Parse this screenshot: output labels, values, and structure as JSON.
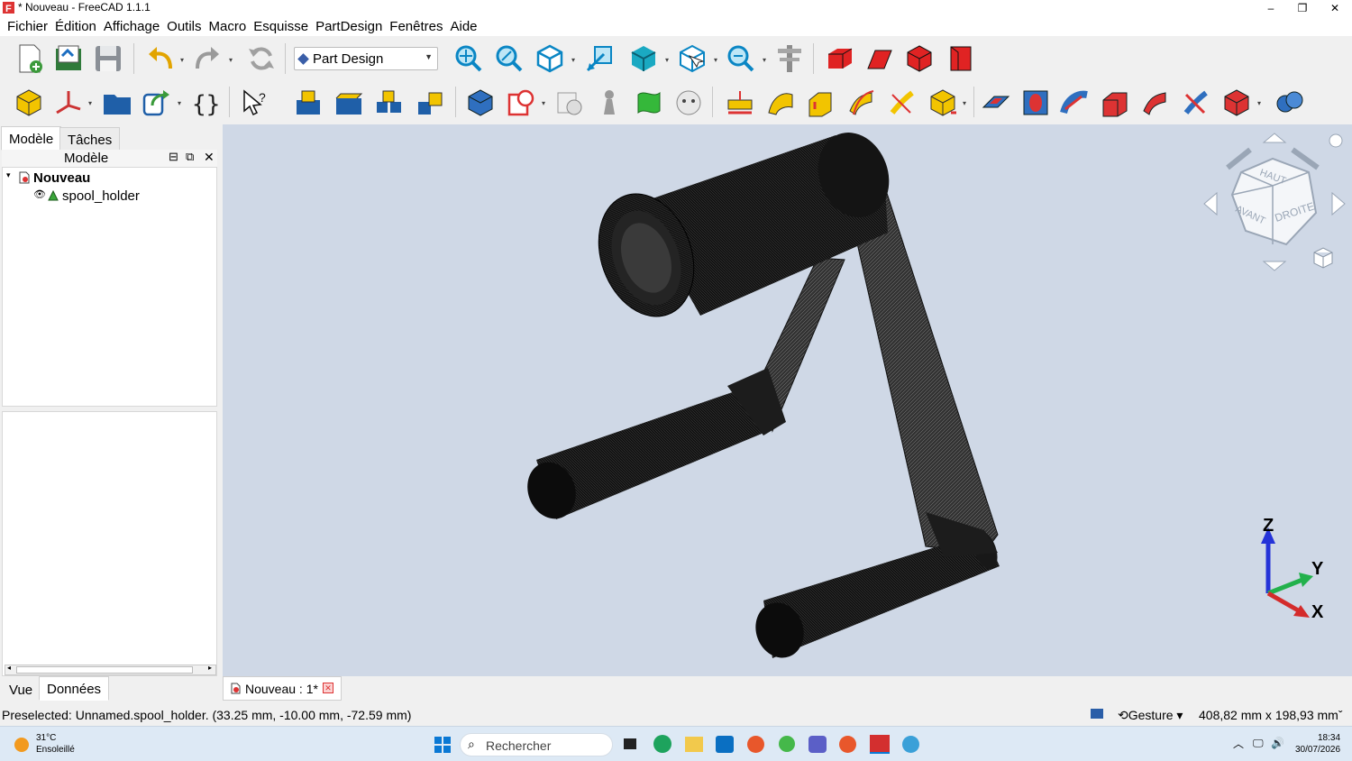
{
  "window": {
    "title": "* Nouveau - FreeCAD 1.1.1",
    "minimize": "–",
    "maximize": "❐",
    "close": "✕"
  },
  "menu": [
    "Fichier",
    "Édition",
    "Affichage",
    "Outils",
    "Macro",
    "Esquisse",
    "PartDesign",
    "Fenêtres",
    "Aide"
  ],
  "workbench": {
    "selected": "Part Design"
  },
  "left_panel": {
    "tabs": [
      "Modèle",
      "Tâches"
    ],
    "active_tab": "Modèle",
    "tree_header": "Modèle",
    "tree": [
      {
        "label": "Nouveau",
        "bold": true
      },
      {
        "label": "spool_holder",
        "bold": false
      }
    ],
    "bottom_tabs": [
      "Vue",
      "Données"
    ],
    "active_bottom_tab": "Données"
  },
  "navcube": {
    "top": "HAUT",
    "front": "AVANT",
    "right": "DROITE"
  },
  "axes": {
    "z": "Z",
    "y": "Y",
    "x": "X"
  },
  "doc_tab": {
    "label": "Nouveau : 1*"
  },
  "status": {
    "message": "Preselected: Unnamed.spool_holder. (33.25 mm, -10.00 mm, -72.59 mm)",
    "nav_style": "Gesture",
    "dimensions": "408,82 mm x 198,93 mm"
  },
  "taskbar": {
    "weather_temp": "31°C",
    "weather_desc": "Ensoleillé",
    "search_placeholder": "Rechercher",
    "time": "18:34",
    "date": "30/07/2026"
  },
  "colors": {
    "viewport_bg": "#cfd8e6",
    "model": "#1a1a1a",
    "accent_red": "#d32f2f",
    "accent_blue": "#1976d2",
    "yellow": "#f2c400"
  }
}
